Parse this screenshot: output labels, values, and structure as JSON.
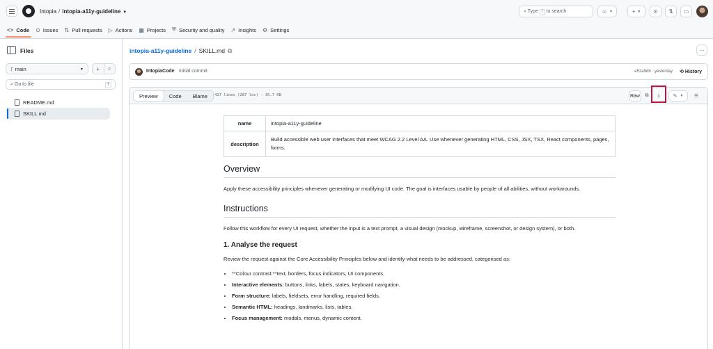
{
  "header": {
    "owner": "Intopia",
    "repo": "intopia-a11y-guideline",
    "search_prefix": "Type",
    "search_key": "/",
    "search_suffix": "to search"
  },
  "repo_nav": [
    {
      "label": "Code",
      "icon": "<>"
    },
    {
      "label": "Issues",
      "icon": "⊙"
    },
    {
      "label": "Pull requests",
      "icon": "⇅"
    },
    {
      "label": "Actions",
      "icon": "▷"
    },
    {
      "label": "Projects",
      "icon": "▦"
    },
    {
      "label": "Security and quality",
      "icon": "⛨"
    },
    {
      "label": "Insights",
      "icon": "↗"
    },
    {
      "label": "Settings",
      "icon": "⚙"
    }
  ],
  "sidebar": {
    "title": "Files",
    "branch": "main",
    "goto_placeholder": "Go to file",
    "goto_key": "T",
    "files": [
      "README.md",
      "SKILL.md"
    ]
  },
  "breadcrumb": {
    "repo": "intopia-a11y-guideline",
    "file": "SKILL.md"
  },
  "commit": {
    "author": "IntopiaCode",
    "message": "Initial commit",
    "meta": "e52a9db · yesterday",
    "history_label": "History"
  },
  "file_header": {
    "tabs": [
      "Preview",
      "Code",
      "Blame"
    ],
    "active_tab": "Preview",
    "stats": "427 lines (287 loc) · 35.7 KB",
    "raw_label": "Raw"
  },
  "doc": {
    "meta_table": [
      {
        "key": "name",
        "value": "intopia-a11y-guideline"
      },
      {
        "key": "description",
        "value": "Build accessible web user interfaces that meet WCAG 2.2 Level AA. Use whenever generating HTML, CSS, JSX, TSX, React components, pages, forms."
      }
    ],
    "overview_heading": "Overview",
    "overview_text": "Apply these accessibility principles whenever generating or modifying UI code. The goal is interfaces usable by people of all abilities, without workarounds.",
    "instructions_heading": "Instructions",
    "instructions_text": "Follow this workflow for every UI request, whether the input is a text prompt, a visual design (mockup, wireframe, screenshot, or design system), or both.",
    "step1_heading": "1. Analyse the request",
    "step1_text": "Review the request against the Core Accessibility Principles below and identify what needs to be addressed, categorised as:",
    "bullets": [
      {
        "bold": "",
        "text": "**Colour contrast:**text, borders, focus indicators, UI components."
      },
      {
        "bold": "Interactive elements:",
        "text": " buttons, links, labels, states, keyboard navigation."
      },
      {
        "bold": "Form structure:",
        "text": " labels, fieldsets, error handling, required fields."
      },
      {
        "bold": "Semantic HTML:",
        "text": " headings, landmarks, lists, tables."
      },
      {
        "bold": "Focus management:",
        "text": " modals, menus, dynamic content."
      }
    ]
  },
  "colors": {
    "link": "#0969da",
    "highlight_box": "#c0143c",
    "nav_underline": "#fd8c73"
  }
}
